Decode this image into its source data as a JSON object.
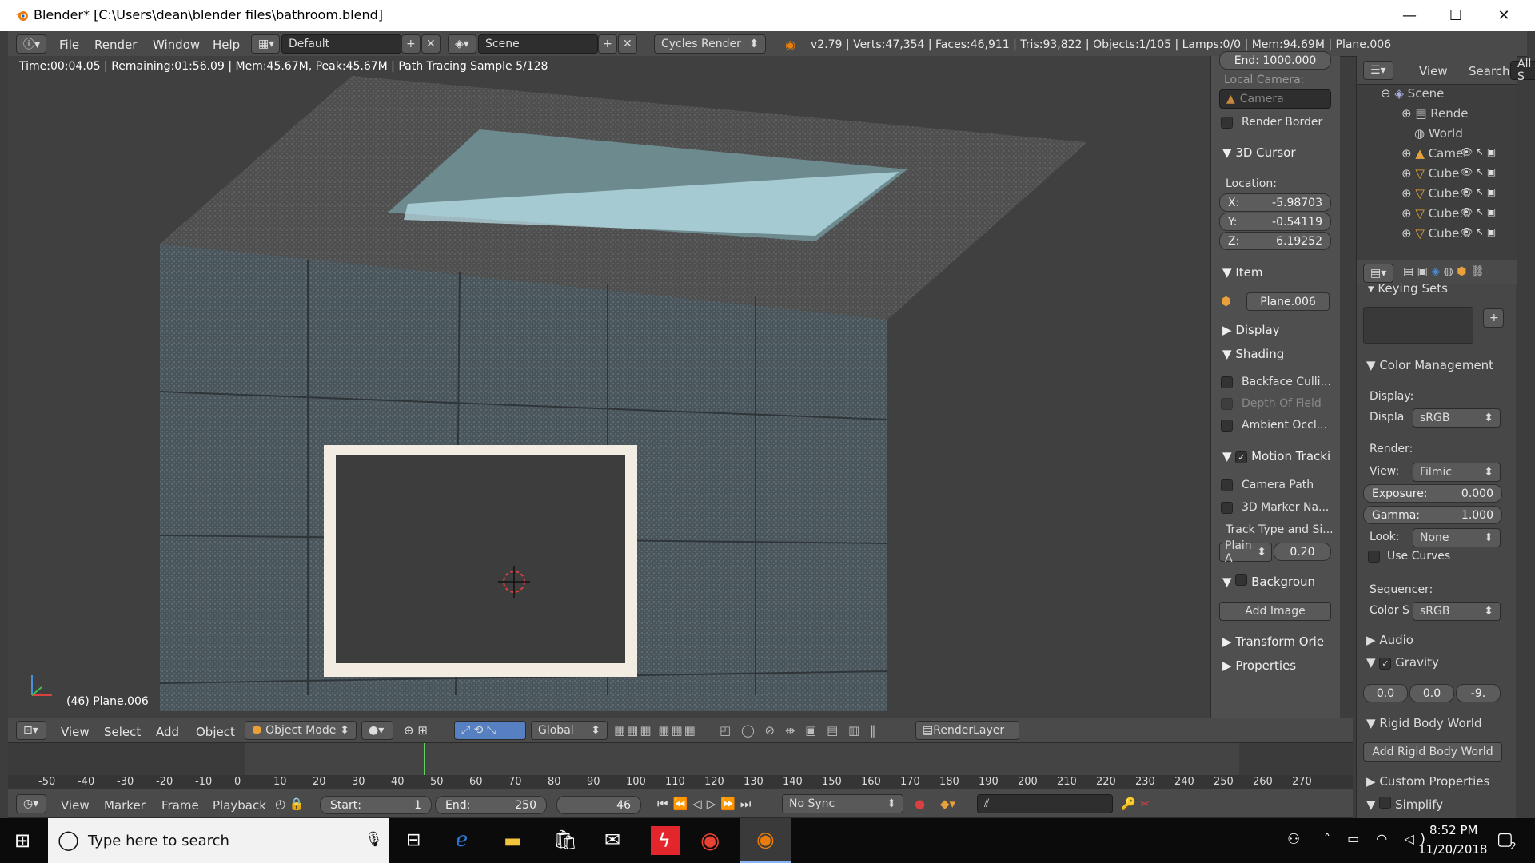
{
  "window": {
    "title": "Blender* [C:\\Users\\dean\\blender files\\bathroom.blend]",
    "minimize": "—",
    "maximize": "☐",
    "close": "✕"
  },
  "topbar": {
    "menus": [
      "File",
      "Render",
      "Window",
      "Help"
    ],
    "layout": "Default",
    "scene": "Scene",
    "engine": "Cycles Render",
    "stats": "v2.79 | Verts:47,354 | Faces:46,911 | Tris:93,822 | Objects:1/105 | Lamps:0/0 | Mem:94.69M | Plane.006"
  },
  "viewport": {
    "render_status": "Time:00:04.05 | Remaining:01:56.09 | Mem:45.67M, Peak:45.67M | Path Tracing Sample 5/128",
    "object_label": "(46) Plane.006"
  },
  "npanel": {
    "end_clip": "End: 1000.000",
    "local_camera_label": "Local Camera:",
    "camera_field": "Camera",
    "render_border": "Render Border",
    "cursor_title": "3D Cursor",
    "location_label": "Location:",
    "x_label": "X:",
    "x_value": "-5.98703",
    "y_label": "Y:",
    "y_value": "-0.54119",
    "z_label": "Z:",
    "z_value": "6.19252",
    "item_title": "Item",
    "item_name": "Plane.006",
    "display_title": "Display",
    "shading_title": "Shading",
    "backface": "Backface Culli...",
    "dof": "Depth Of Field",
    "ao": "Ambient Occl...",
    "motion_title": "Motion Tracki",
    "camera_path": "Camera Path",
    "marker_names": "3D Marker Na...",
    "track_type": "Track Type and Si...",
    "plain": "Plain A",
    "plain_size": "0.20",
    "background_title": "Backgroun",
    "add_image": "Add Image",
    "transform_orient": "Transform Orie",
    "properties_title": "Properties"
  },
  "outliner": {
    "view": "View",
    "search": "Search",
    "all": "All S",
    "scene": "Scene",
    "items": [
      "Rende",
      "World",
      "Camer",
      "Cube",
      "Cube.0",
      "Cube.0",
      "Cube.0"
    ]
  },
  "props": {
    "keying_sets": "Keying Sets",
    "color_mgmt": "Color Management",
    "display_label": "Display:",
    "displa": "Displa",
    "display_value": "sRGB",
    "render_label": "Render:",
    "view_label": "View:",
    "view_value": "Filmic",
    "exposure_label": "Exposure:",
    "exposure_value": "0.000",
    "gamma_label": "Gamma:",
    "gamma_value": "1.000",
    "look_label": "Look:",
    "look_value": "None",
    "use_curves": "Use Curves",
    "sequencer_label": "Sequencer:",
    "color_s": "Color S",
    "color_s_value": "sRGB",
    "audio": "Audio",
    "gravity": "Gravity",
    "grav_x": "0.0",
    "grav_y": "0.0",
    "grav_z": "-9.",
    "rigid_body": "Rigid Body World",
    "add_rigid": "Add Rigid Body World",
    "custom_props": "Custom Properties",
    "simplify": "Simplify"
  },
  "viewport_header": {
    "menus": [
      "View",
      "Select",
      "Add",
      "Object"
    ],
    "mode": "Object Mode",
    "orientation": "Global",
    "render_layer": "RenderLayer"
  },
  "timeline": {
    "ticks": [
      "-50",
      "-40",
      "-30",
      "-20",
      "-10",
      "0",
      "10",
      "20",
      "30",
      "40",
      "50",
      "60",
      "70",
      "80",
      "90",
      "100",
      "110",
      "120",
      "130",
      "140",
      "150",
      "160",
      "170",
      "180",
      "190",
      "200",
      "210",
      "220",
      "230",
      "240",
      "250",
      "260",
      "270"
    ],
    "menus": [
      "View",
      "Marker",
      "Frame",
      "Playback"
    ],
    "start_label": "Start:",
    "start_value": "1",
    "end_label": "End:",
    "end_value": "250",
    "current": "46",
    "sync": "No Sync"
  },
  "taskbar": {
    "search_placeholder": "Type here to search",
    "time": "8:52 PM",
    "date": "11/20/2018",
    "notif": "2"
  },
  "colors": {
    "accent": "#5680c2",
    "blender_orange": "#e87d0d",
    "dark_panel": "#3d3d3d"
  }
}
